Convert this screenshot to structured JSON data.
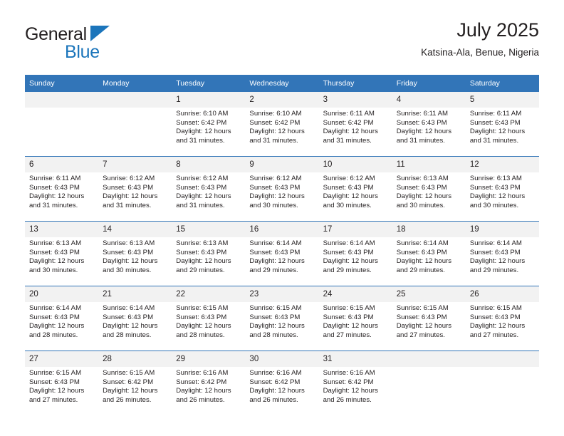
{
  "brand": {
    "name_top": "General",
    "name_bottom": "Blue",
    "colors": {
      "accent": "#1b75bb",
      "header": "#3275b8",
      "daynum_bg": "#f2f2f2"
    }
  },
  "header": {
    "title": "July 2025",
    "subtitle": "Katsina-Ala, Benue, Nigeria"
  },
  "weekday_headers": [
    "Sunday",
    "Monday",
    "Tuesday",
    "Wednesday",
    "Thursday",
    "Friday",
    "Saturday"
  ],
  "weeks": [
    [
      {
        "day": "",
        "lines": []
      },
      {
        "day": "",
        "lines": []
      },
      {
        "day": "1",
        "lines": [
          "Sunrise: 6:10 AM",
          "Sunset: 6:42 PM",
          "Daylight: 12 hours",
          "and 31 minutes."
        ]
      },
      {
        "day": "2",
        "lines": [
          "Sunrise: 6:10 AM",
          "Sunset: 6:42 PM",
          "Daylight: 12 hours",
          "and 31 minutes."
        ]
      },
      {
        "day": "3",
        "lines": [
          "Sunrise: 6:11 AM",
          "Sunset: 6:42 PM",
          "Daylight: 12 hours",
          "and 31 minutes."
        ]
      },
      {
        "day": "4",
        "lines": [
          "Sunrise: 6:11 AM",
          "Sunset: 6:43 PM",
          "Daylight: 12 hours",
          "and 31 minutes."
        ]
      },
      {
        "day": "5",
        "lines": [
          "Sunrise: 6:11 AM",
          "Sunset: 6:43 PM",
          "Daylight: 12 hours",
          "and 31 minutes."
        ]
      }
    ],
    [
      {
        "day": "6",
        "lines": [
          "Sunrise: 6:11 AM",
          "Sunset: 6:43 PM",
          "Daylight: 12 hours",
          "and 31 minutes."
        ]
      },
      {
        "day": "7",
        "lines": [
          "Sunrise: 6:12 AM",
          "Sunset: 6:43 PM",
          "Daylight: 12 hours",
          "and 31 minutes."
        ]
      },
      {
        "day": "8",
        "lines": [
          "Sunrise: 6:12 AM",
          "Sunset: 6:43 PM",
          "Daylight: 12 hours",
          "and 31 minutes."
        ]
      },
      {
        "day": "9",
        "lines": [
          "Sunrise: 6:12 AM",
          "Sunset: 6:43 PM",
          "Daylight: 12 hours",
          "and 30 minutes."
        ]
      },
      {
        "day": "10",
        "lines": [
          "Sunrise: 6:12 AM",
          "Sunset: 6:43 PM",
          "Daylight: 12 hours",
          "and 30 minutes."
        ]
      },
      {
        "day": "11",
        "lines": [
          "Sunrise: 6:13 AM",
          "Sunset: 6:43 PM",
          "Daylight: 12 hours",
          "and 30 minutes."
        ]
      },
      {
        "day": "12",
        "lines": [
          "Sunrise: 6:13 AM",
          "Sunset: 6:43 PM",
          "Daylight: 12 hours",
          "and 30 minutes."
        ]
      }
    ],
    [
      {
        "day": "13",
        "lines": [
          "Sunrise: 6:13 AM",
          "Sunset: 6:43 PM",
          "Daylight: 12 hours",
          "and 30 minutes."
        ]
      },
      {
        "day": "14",
        "lines": [
          "Sunrise: 6:13 AM",
          "Sunset: 6:43 PM",
          "Daylight: 12 hours",
          "and 30 minutes."
        ]
      },
      {
        "day": "15",
        "lines": [
          "Sunrise: 6:13 AM",
          "Sunset: 6:43 PM",
          "Daylight: 12 hours",
          "and 29 minutes."
        ]
      },
      {
        "day": "16",
        "lines": [
          "Sunrise: 6:14 AM",
          "Sunset: 6:43 PM",
          "Daylight: 12 hours",
          "and 29 minutes."
        ]
      },
      {
        "day": "17",
        "lines": [
          "Sunrise: 6:14 AM",
          "Sunset: 6:43 PM",
          "Daylight: 12 hours",
          "and 29 minutes."
        ]
      },
      {
        "day": "18",
        "lines": [
          "Sunrise: 6:14 AM",
          "Sunset: 6:43 PM",
          "Daylight: 12 hours",
          "and 29 minutes."
        ]
      },
      {
        "day": "19",
        "lines": [
          "Sunrise: 6:14 AM",
          "Sunset: 6:43 PM",
          "Daylight: 12 hours",
          "and 29 minutes."
        ]
      }
    ],
    [
      {
        "day": "20",
        "lines": [
          "Sunrise: 6:14 AM",
          "Sunset: 6:43 PM",
          "Daylight: 12 hours",
          "and 28 minutes."
        ]
      },
      {
        "day": "21",
        "lines": [
          "Sunrise: 6:14 AM",
          "Sunset: 6:43 PM",
          "Daylight: 12 hours",
          "and 28 minutes."
        ]
      },
      {
        "day": "22",
        "lines": [
          "Sunrise: 6:15 AM",
          "Sunset: 6:43 PM",
          "Daylight: 12 hours",
          "and 28 minutes."
        ]
      },
      {
        "day": "23",
        "lines": [
          "Sunrise: 6:15 AM",
          "Sunset: 6:43 PM",
          "Daylight: 12 hours",
          "and 28 minutes."
        ]
      },
      {
        "day": "24",
        "lines": [
          "Sunrise: 6:15 AM",
          "Sunset: 6:43 PM",
          "Daylight: 12 hours",
          "and 27 minutes."
        ]
      },
      {
        "day": "25",
        "lines": [
          "Sunrise: 6:15 AM",
          "Sunset: 6:43 PM",
          "Daylight: 12 hours",
          "and 27 minutes."
        ]
      },
      {
        "day": "26",
        "lines": [
          "Sunrise: 6:15 AM",
          "Sunset: 6:43 PM",
          "Daylight: 12 hours",
          "and 27 minutes."
        ]
      }
    ],
    [
      {
        "day": "27",
        "lines": [
          "Sunrise: 6:15 AM",
          "Sunset: 6:43 PM",
          "Daylight: 12 hours",
          "and 27 minutes."
        ]
      },
      {
        "day": "28",
        "lines": [
          "Sunrise: 6:15 AM",
          "Sunset: 6:42 PM",
          "Daylight: 12 hours",
          "and 26 minutes."
        ]
      },
      {
        "day": "29",
        "lines": [
          "Sunrise: 6:16 AM",
          "Sunset: 6:42 PM",
          "Daylight: 12 hours",
          "and 26 minutes."
        ]
      },
      {
        "day": "30",
        "lines": [
          "Sunrise: 6:16 AM",
          "Sunset: 6:42 PM",
          "Daylight: 12 hours",
          "and 26 minutes."
        ]
      },
      {
        "day": "31",
        "lines": [
          "Sunrise: 6:16 AM",
          "Sunset: 6:42 PM",
          "Daylight: 12 hours",
          "and 26 minutes."
        ]
      },
      {
        "day": "",
        "lines": []
      },
      {
        "day": "",
        "lines": []
      }
    ]
  ]
}
